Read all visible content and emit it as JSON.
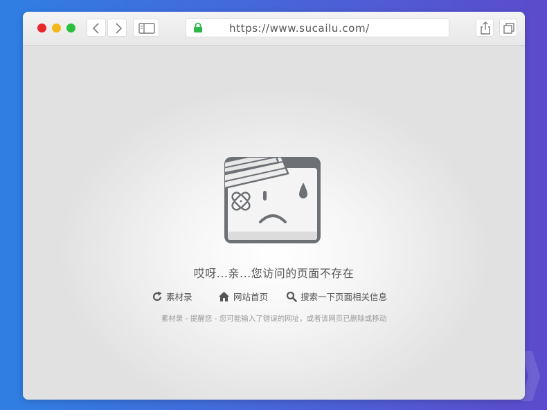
{
  "browser": {
    "url": "https://www.sucailu.com/"
  },
  "error_page": {
    "headline": "哎呀...亲...您访问的页面不存在",
    "links": [
      {
        "label": "素材录"
      },
      {
        "label": "网站首页"
      },
      {
        "label": "搜索一下页面相关信息"
      }
    ],
    "note": "素材录 - 提醒您 - 您可能输入了错误的网址，或者该网页已删除或移动"
  },
  "colors": {
    "close": "#e9262b",
    "minimize": "#f4b81c",
    "maximize": "#2bbf3f",
    "lock": "#2bb84a",
    "face_frame": "#6d7075"
  },
  "icons": {
    "refresh": "refresh-icon",
    "home": "home-icon",
    "search": "search-icon",
    "lock": "lock-icon"
  }
}
